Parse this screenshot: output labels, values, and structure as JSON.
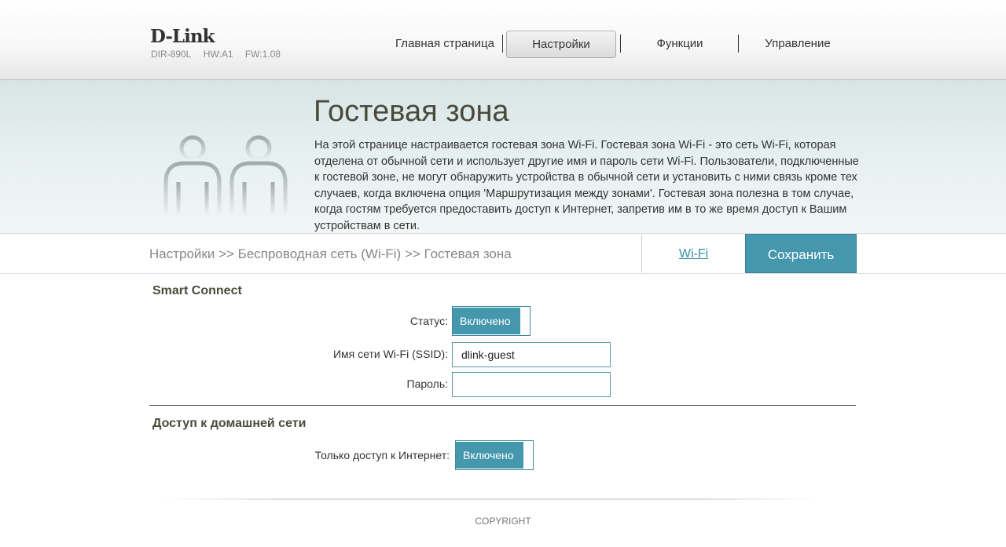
{
  "header": {
    "logo": "D-Link",
    "model": "DIR-890L",
    "hw": "HW:A1",
    "fw": "FW:1.08",
    "nav": [
      {
        "label": "Главная страница"
      },
      {
        "label": "Настройки"
      },
      {
        "label": "Функции"
      },
      {
        "label": "Управление"
      }
    ]
  },
  "banner": {
    "title": "Гостевая зона",
    "description": "На этой странице настраивается гостевая зона Wi-Fi. Гостевая зона Wi-Fi - это сеть Wi-Fi, которая отделена от обычной сети и использует другие имя и пароль сети Wi-Fi. Пользователи, подключенные к гостевой зоне, не могут обнаружить устройства в обычной сети и установить с ними связь кроме тех случаев, когда включена опция 'Маршрутизация между зонами'. Гостевая зона полезна в том случае, когда гостям требуется предоставить доступ к Интернет, запретив им в то же время доступ к Вашим устройствам в сети."
  },
  "breadcrumb": "Настройки >> Беспроводная сеть (Wi-Fi) >> Гостевая зона",
  "wifi_link": "Wi-Fi",
  "save_label": "Сохранить",
  "smart_connect": {
    "title": "Smart Connect",
    "status_label": "Статус:",
    "status_value": "Включено",
    "ssid_label": "Имя сети Wi-Fi (SSID):",
    "ssid_value": "dlink-guest",
    "password_label": "Пароль:",
    "password_value": ""
  },
  "home_access": {
    "title": "Доступ к домашней сети",
    "internet_only_label": "Только доступ к Интернет:",
    "internet_only_value": "Включено"
  },
  "footer": {
    "copyright": "COPYRIGHT"
  },
  "colors": {
    "accent": "#4597ad",
    "link": "#3a8fa6"
  }
}
